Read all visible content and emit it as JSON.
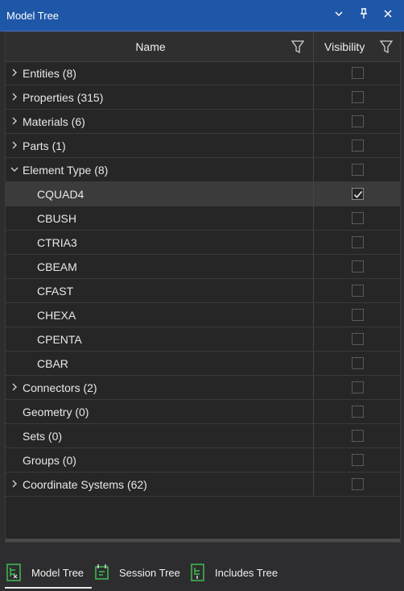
{
  "window": {
    "title": "Model Tree",
    "buttons": [
      "chevron-down-icon",
      "pin-icon",
      "close-icon"
    ]
  },
  "columns": {
    "name": "Name",
    "visibility": "Visibility"
  },
  "rows": [
    {
      "label": "Entities (8)",
      "expander": "collapsed",
      "indent": 0,
      "checked": false,
      "selected": false
    },
    {
      "label": "Properties (315)",
      "expander": "collapsed",
      "indent": 0,
      "checked": false,
      "selected": false
    },
    {
      "label": "Materials (6)",
      "expander": "collapsed",
      "indent": 0,
      "checked": false,
      "selected": false
    },
    {
      "label": "Parts (1)",
      "expander": "collapsed",
      "indent": 0,
      "checked": false,
      "selected": false
    },
    {
      "label": "Element Type (8)",
      "expander": "expanded",
      "indent": 0,
      "checked": false,
      "selected": false
    },
    {
      "label": "CQUAD4",
      "expander": "none",
      "indent": 1,
      "checked": true,
      "selected": true
    },
    {
      "label": "CBUSH",
      "expander": "none",
      "indent": 1,
      "checked": false,
      "selected": false
    },
    {
      "label": "CTRIA3",
      "expander": "none",
      "indent": 1,
      "checked": false,
      "selected": false
    },
    {
      "label": "CBEAM",
      "expander": "none",
      "indent": 1,
      "checked": false,
      "selected": false
    },
    {
      "label": "CFAST",
      "expander": "none",
      "indent": 1,
      "checked": false,
      "selected": false
    },
    {
      "label": "CHEXA",
      "expander": "none",
      "indent": 1,
      "checked": false,
      "selected": false
    },
    {
      "label": "CPENTA",
      "expander": "none",
      "indent": 1,
      "checked": false,
      "selected": false
    },
    {
      "label": "CBAR",
      "expander": "none",
      "indent": 1,
      "checked": false,
      "selected": false
    },
    {
      "label": "Connectors (2)",
      "expander": "collapsed",
      "indent": 0,
      "checked": false,
      "selected": false
    },
    {
      "label": "Geometry (0)",
      "expander": "none",
      "indent": 0,
      "checked": false,
      "selected": false
    },
    {
      "label": "Sets (0)",
      "expander": "none",
      "indent": 0,
      "checked": false,
      "selected": false
    },
    {
      "label": "Groups (0)",
      "expander": "none",
      "indent": 0,
      "checked": false,
      "selected": false
    },
    {
      "label": "Coordinate Systems (62)",
      "expander": "collapsed",
      "indent": 0,
      "checked": false,
      "selected": false
    }
  ],
  "tabs": [
    {
      "label": "Model Tree",
      "icon": "model-tree-icon",
      "active": true
    },
    {
      "label": "Session Tree",
      "icon": "session-tree-icon",
      "active": false
    },
    {
      "label": "Includes Tree",
      "icon": "includes-tree-icon",
      "active": false
    }
  ],
  "colors": {
    "titlebar": "#1f57a8",
    "icon_green": "#3fbf4f"
  }
}
